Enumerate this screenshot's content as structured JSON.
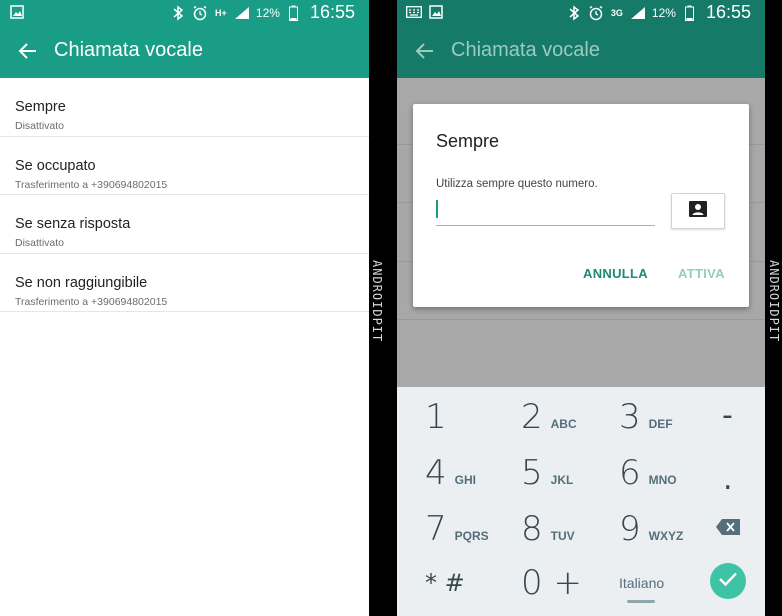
{
  "left": {
    "status": {
      "battery": "12%",
      "time": "16:55",
      "network": "H+"
    },
    "appbar": {
      "title": "Chiamata vocale"
    },
    "items": [
      {
        "title": "Sempre",
        "subtitle": "Disattivato"
      },
      {
        "title": "Se occupato",
        "subtitle": "Trasferimento a +390694802015"
      },
      {
        "title": "Se senza risposta",
        "subtitle": "Disattivato"
      },
      {
        "title": "Se non raggiungibile",
        "subtitle": "Trasferimento a +390694802015"
      }
    ]
  },
  "right": {
    "status": {
      "battery": "12%",
      "time": "16:55",
      "network": "3G"
    },
    "appbar": {
      "title": "Chiamata vocale"
    },
    "dialog": {
      "title": "Sempre",
      "message": "Utilizza sempre questo numero.",
      "input_value": "",
      "cancel_label": "ANNULLA",
      "confirm_label": "ATTIVA"
    },
    "keypad": {
      "keys": [
        {
          "num": "1",
          "letters": ""
        },
        {
          "num": "2",
          "letters": "ABC"
        },
        {
          "num": "3",
          "letters": "DEF"
        },
        {
          "num": "-",
          "letters": ""
        },
        {
          "num": "4",
          "letters": "GHI"
        },
        {
          "num": "5",
          "letters": "JKL"
        },
        {
          "num": "6",
          "letters": "MNO"
        },
        {
          "num": ".",
          "letters": ""
        },
        {
          "num": "7",
          "letters": "PQRS"
        },
        {
          "num": "8",
          "letters": "TUV"
        },
        {
          "num": "9",
          "letters": "WXYZ"
        },
        {
          "num": "* #",
          "letters": ""
        },
        {
          "num": "0 +",
          "letters": ""
        }
      ],
      "language": "Italiano"
    }
  },
  "watermark": "ANDROIDPIT",
  "colors": {
    "primary": "#199d86",
    "primary_dark": "#157a68",
    "accent": "#3dc3a5"
  },
  "icons": [
    "gallery-icon",
    "bluetooth-icon",
    "alarm-icon",
    "signal-icon",
    "battery-icon",
    "back-arrow-icon",
    "contact-icon",
    "backspace-icon",
    "check-icon",
    "keyboard-icon"
  ]
}
